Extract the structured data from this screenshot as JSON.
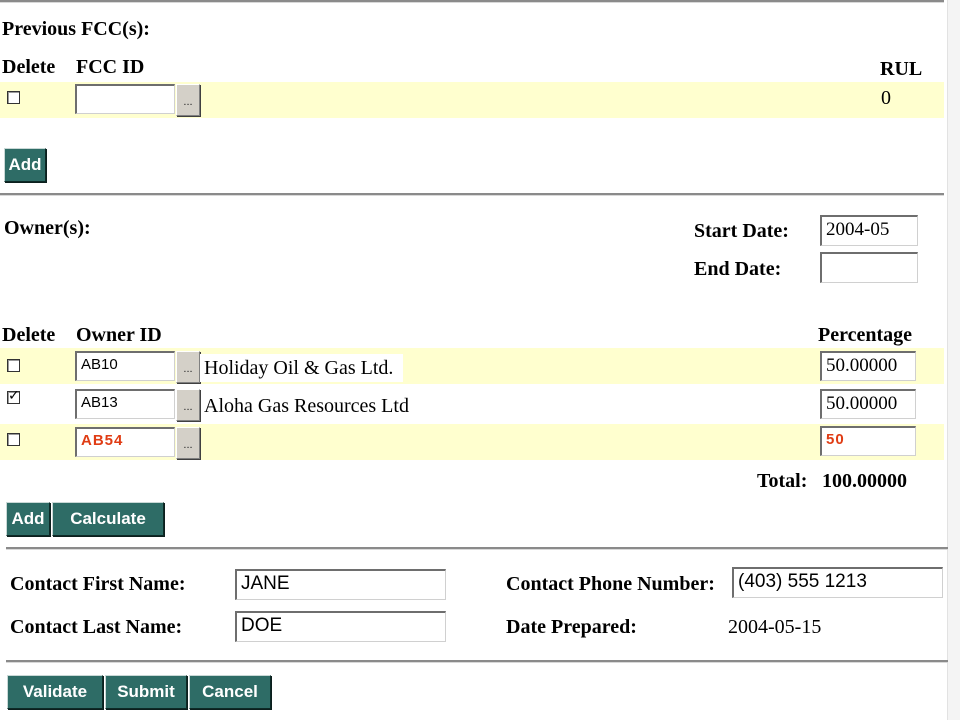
{
  "previous_fcc": {
    "heading": "Previous FCC(s):",
    "columns": {
      "delete": "Delete",
      "fcc_id": "FCC ID",
      "rul": "RUL"
    },
    "rows": [
      {
        "checked": false,
        "fcc_id": "",
        "rul": "0"
      }
    ],
    "add_label": "Add",
    "lookup_label": "..."
  },
  "owners": {
    "heading": "Owner(s):",
    "start_date_label": "Start Date:",
    "start_date_value": "2004-05",
    "end_date_label": "End Date:",
    "end_date_value": "",
    "columns": {
      "delete": "Delete",
      "owner_id": "Owner ID",
      "percentage": "Percentage"
    },
    "rows": [
      {
        "checked": false,
        "owner_id": "AB10",
        "name": "Holiday Oil & Gas Ltd.",
        "percentage": "50.00000"
      },
      {
        "checked": true,
        "owner_id": "AB13",
        "name": "Aloha Gas Resources Ltd",
        "percentage": "50.00000"
      },
      {
        "checked": false,
        "owner_id": "AB54",
        "name": "",
        "percentage": "50"
      }
    ],
    "total_label": "Total:",
    "total_value": "100.00000",
    "add_label": "Add",
    "calculate_label": "Calculate",
    "lookup_label": "..."
  },
  "contact": {
    "first_name_label": "Contact First Name:",
    "first_name_value": "JANE",
    "last_name_label": "Contact Last Name:",
    "last_name_value": "DOE",
    "phone_label": "Contact Phone Number:",
    "phone_value": "(403) 555 1213",
    "date_prepared_label": "Date Prepared:",
    "date_prepared_value": "2004-05-15"
  },
  "actions": {
    "validate_label": "Validate",
    "submit_label": "Submit",
    "cancel_label": "Cancel"
  },
  "colors": {
    "row_highlight": "#ffffcf",
    "button_bg": "#2e6c66",
    "error_text": "#e03c14"
  }
}
